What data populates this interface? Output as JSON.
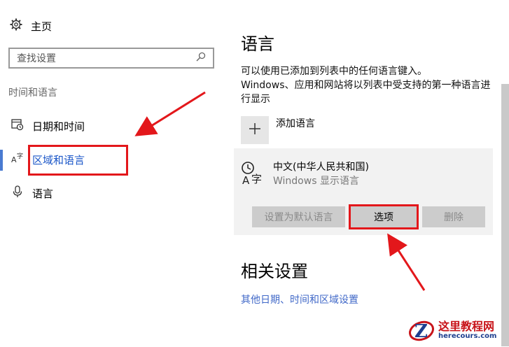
{
  "nav": {
    "home_label": "主页",
    "search_placeholder": "查找设置",
    "section_label": "时间和语言",
    "items": [
      {
        "label": "日期和时间"
      },
      {
        "label": "区域和语言"
      },
      {
        "label": "语言"
      }
    ]
  },
  "main": {
    "title": "语言",
    "description_line1": "可以使用已添加到列表中的任何语言键入。",
    "description_line2": "Windows、应用和网站将以列表中受支持的第一种语言进行显示",
    "add_language_label": "添加语言",
    "language": {
      "name": "中文(中华人民共和国)",
      "subtitle": "Windows 显示语言"
    },
    "buttons": {
      "set_default": "设置为默认语言",
      "options": "选项",
      "remove": "删除"
    },
    "related_title": "相关设置",
    "related_link": "其他日期、时间和区域设置"
  },
  "watermark": {
    "name": "这里教程网",
    "url": "herecours.com"
  },
  "colors": {
    "accent": "#1a56c8",
    "annotation_red": "#e3171b",
    "link": "#4169c8"
  }
}
